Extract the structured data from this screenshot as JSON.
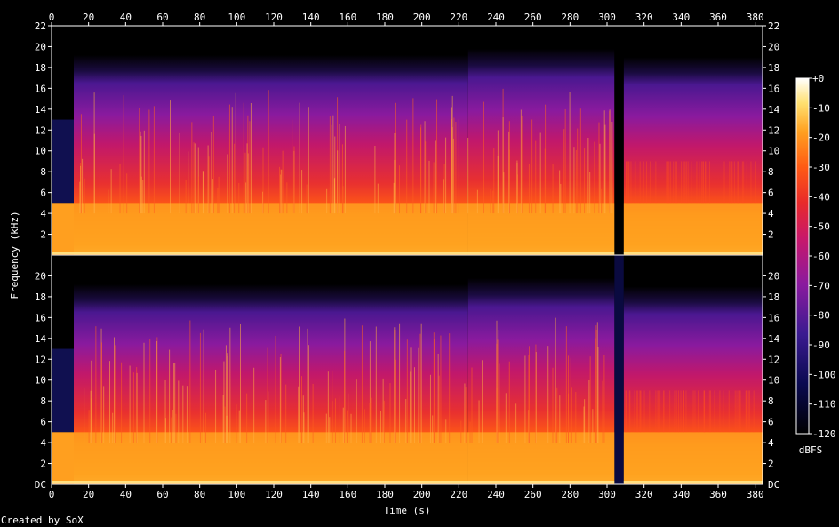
{
  "chart_data": {
    "type": "heatmap",
    "description_source": "SoX spectrogram, two channels",
    "x": {
      "label": "Time (s)",
      "ticks": [
        0,
        20,
        40,
        60,
        80,
        100,
        120,
        140,
        160,
        180,
        200,
        220,
        240,
        260,
        280,
        300,
        320,
        340,
        360,
        380
      ],
      "range": [
        0,
        384
      ]
    },
    "y": {
      "label": "Frequency (kHz)",
      "ticks": [
        "22",
        "20",
        "18",
        "16",
        "14",
        "12",
        "10",
        "8",
        "6",
        "4",
        "2"
      ],
      "bottom_tick": "DC",
      "range": [
        0,
        22
      ]
    },
    "channels": 2,
    "colorbar": {
      "label": "dBFS",
      "ticks": [
        "+0",
        "-10",
        "-20",
        "-30",
        "-40",
        "-50",
        "-60",
        "-70",
        "-80",
        "-90",
        "-100",
        "-110",
        "-120"
      ],
      "range": [
        -120,
        0
      ]
    },
    "notes": {
      "highcut_khz_segments": [
        {
          "t0": 12,
          "t1": 225,
          "top_khz": 19.2
        },
        {
          "t0": 225,
          "t1": 304,
          "top_khz": 19.8
        },
        {
          "t0": 309,
          "t1": 384,
          "top_khz": 19.0
        }
      ],
      "gap_seconds": [
        304,
        309
      ]
    },
    "colors": {
      "quiet": "#000000",
      "low": "#1a0b5e",
      "mid_low": "#6a1a9e",
      "mid": "#d8204a",
      "mid_high": "#ff6a10",
      "high": "#ffd040",
      "max": "#ffffff"
    }
  },
  "footer": {
    "credit": "Created by SoX"
  }
}
